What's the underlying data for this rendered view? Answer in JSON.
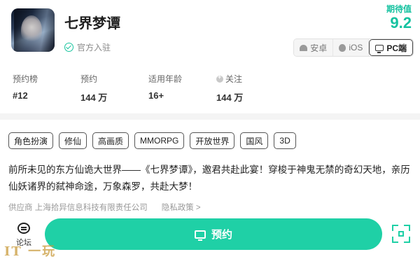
{
  "header": {
    "title": "七界梦谭",
    "verified_text": "官方入驻",
    "score_label": "期待值",
    "score_value": "9.2"
  },
  "platforms": [
    {
      "label": "安卓",
      "icon": "android-icon",
      "active": false
    },
    {
      "label": "iOS",
      "icon": "apple-icon",
      "active": false
    },
    {
      "label": "PC端",
      "icon": "monitor-icon",
      "active": true
    }
  ],
  "stats": [
    {
      "label": "预约榜",
      "value": "#12"
    },
    {
      "label": "预约",
      "value": "144 万"
    },
    {
      "label": "适用年龄",
      "value": "16+"
    },
    {
      "label": "关注",
      "value": "144 万"
    }
  ],
  "tags": [
    "角色扮演",
    "修仙",
    "高画质",
    "MMORPG",
    "开放世界",
    "国风",
    "3D"
  ],
  "description": "前所未见的东方仙诡大世界——《七界梦谭》，邀君共赴此宴！穿梭于神鬼无禁的奇幻天地，亲历仙妖诸界的弑神命途，万象森罗，共赴大梦！",
  "provider": {
    "text": "供应商 上海拾异信息科技有限责任公司",
    "privacy": "隐私政策 >"
  },
  "bottom_bar": {
    "forum_label": "论坛",
    "reserve_label": "预约",
    "accent_color": "#1fd0a6"
  },
  "watermark": "IT 一玩"
}
